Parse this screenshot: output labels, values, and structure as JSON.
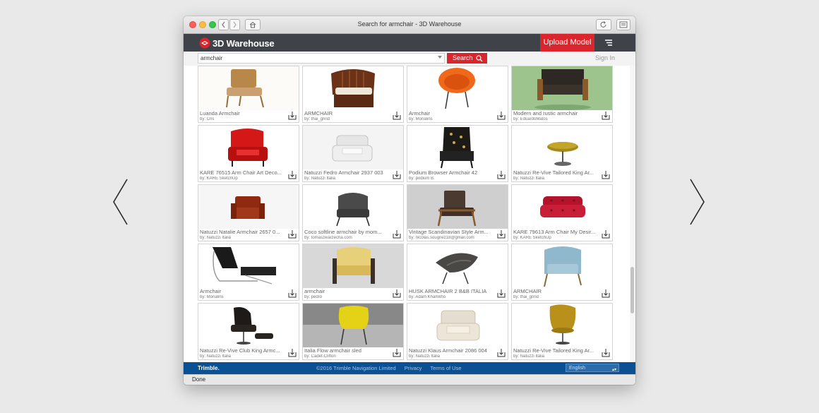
{
  "window": {
    "title": "Search for armchair - 3D Warehouse"
  },
  "header": {
    "logo_text": "3D Warehouse",
    "upload_label": "Upload Model"
  },
  "search": {
    "value": "armchair",
    "button_label": "Search",
    "signin_label": "Sign In"
  },
  "models": [
    {
      "title": "Luanda Armchair",
      "author": "by: Cris"
    },
    {
      "title": "ARMCHAIR",
      "author": "by: thai_grind"
    },
    {
      "title": "Armchair",
      "author": "by: Monalins"
    },
    {
      "title": "Modern and rustic armchair",
      "author": "by: EduardoMatos"
    },
    {
      "title": "KARE 76515 Arm Chair Art Deco...",
      "author": "by: KARE SketchUp"
    },
    {
      "title": "Natuzzi Fedro Armchair 2937 003",
      "author": "by: Natuzzi Italia"
    },
    {
      "title": "Podium Browser Armchair 42",
      "author": "by: podium B."
    },
    {
      "title": "Natuzzi Re-Vive Tailored King Ar...",
      "author": "by: Natuzzi Italia"
    },
    {
      "title": "Natuzzi Natalie Armchair 2657 0...",
      "author": "by: Natuzzi Italia"
    },
    {
      "title": "Coco softline armchair by mom...",
      "author": "by: tomaszwarzecha.com"
    },
    {
      "title": "Vintage Scandinavian Style Arm...",
      "author": "by: nicolas.sougnez18@gmail.com"
    },
    {
      "title": "KARE 79613 Arm Chair My Desir...",
      "author": "by: KARE SketchUp"
    },
    {
      "title": "Armchair",
      "author": "by: Monalins"
    },
    {
      "title": "armchair",
      "author": "by: pedro"
    },
    {
      "title": "HUSK ARMCHAIR 2 B&B ITALIA",
      "author": "by: Adam Khamkho"
    },
    {
      "title": "ARMCHAIR",
      "author": "by: thai_grind"
    },
    {
      "title": "Natuzzi Re-Vive Club King Armc...",
      "author": "by: Natuzzi Italia"
    },
    {
      "title": "Italia Flow armchair sled",
      "author": "by: Cadet-Clifton"
    },
    {
      "title": "Natuzzi Klaus Armchair 2086 004",
      "author": "by: Natuzzi Italia"
    },
    {
      "title": "Natuzzi Re-Vive Tailored King Ar...",
      "author": "by: Natuzzi Italia"
    }
  ],
  "footer": {
    "brand": "Trimble.",
    "copyright": "©2016 Trimble Navigation Limited",
    "privacy": "Privacy",
    "terms": "Terms of Use",
    "language": "English"
  },
  "status": {
    "text": "Done"
  },
  "colors": {
    "accent": "#d9252b",
    "header": "#3f4349",
    "footer": "#0a5093"
  }
}
